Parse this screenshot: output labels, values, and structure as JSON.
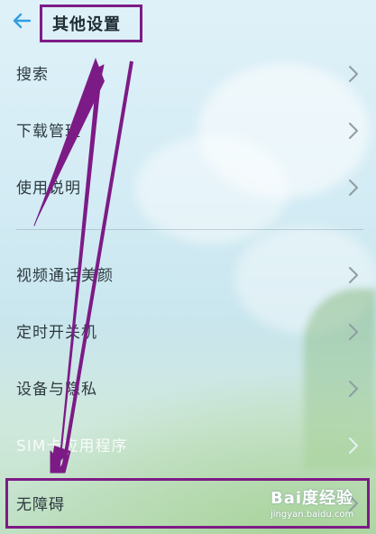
{
  "header": {
    "title": "其他设置",
    "back_icon": "back-arrow-icon"
  },
  "items": [
    {
      "label": "搜索"
    },
    {
      "label": "下载管理"
    },
    {
      "label": "使用说明"
    },
    {
      "label": "视频通话美颜"
    },
    {
      "label": "定时开关机"
    },
    {
      "label": "设备与隐私"
    },
    {
      "label": "SIM卡应用程序"
    },
    {
      "label": "无障碍"
    }
  ],
  "watermark": {
    "main": "Bai度经验",
    "sub": "jingyan.baidu.com"
  },
  "colors": {
    "accent": "#2f9ee0",
    "annotation": "#7d1b86"
  }
}
